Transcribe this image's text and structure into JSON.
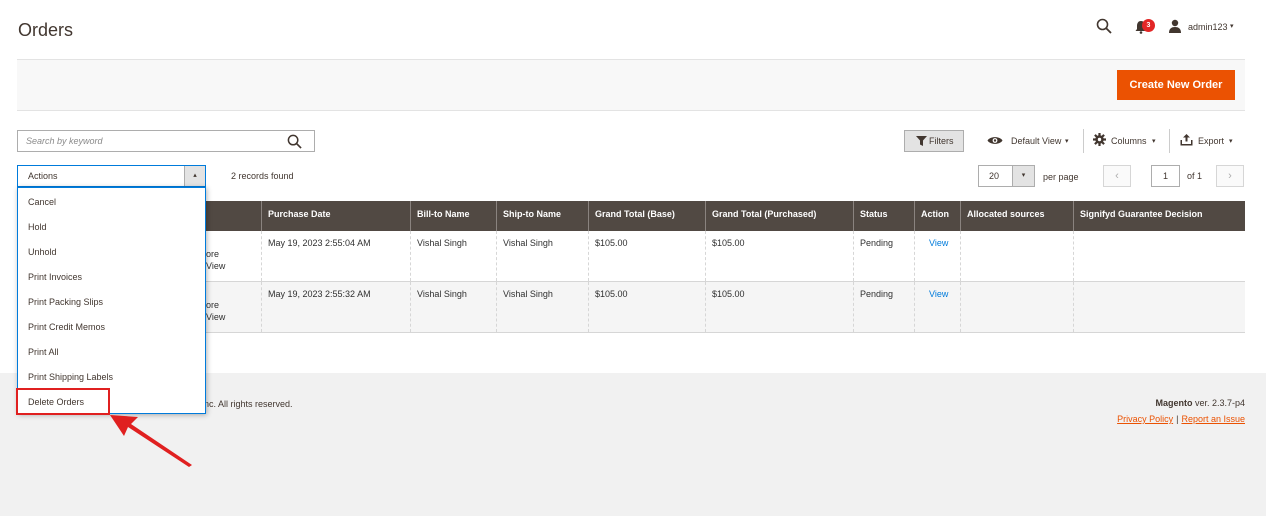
{
  "header": {
    "title": "Orders",
    "notification_count": "3",
    "username": "admin123",
    "caret": "▾"
  },
  "toolbar": {
    "create_label": "Create New Order",
    "search_placeholder": "Search by keyword",
    "filters_label": "Filters",
    "view_label": "Default View",
    "columns_label": "Columns",
    "export_label": "Export"
  },
  "mass_actions": {
    "label": "Actions",
    "toggle": "▴",
    "records": "2 records found",
    "options": [
      "Cancel",
      "Hold",
      "Unhold",
      "Print Invoices",
      "Print Packing Slips",
      "Print Credit Memos",
      "Print All",
      "Print Shipping Labels",
      "Delete Orders"
    ]
  },
  "pagination": {
    "per_page_value": "20",
    "per_page_toggle": "▾",
    "per_page_label": "per page",
    "prev": "‹",
    "next": "›",
    "page": "1",
    "of": "of 1"
  },
  "grid": {
    "columns": [
      "Purchase Date",
      "Bill-to Name",
      "Ship-to Name",
      "Grand Total (Base)",
      "Grand Total (Purchased)",
      "Status",
      "Action",
      "Allocated sources",
      "Signifyd Guarantee Decision"
    ],
    "partial_text": [
      "ore",
      "View"
    ],
    "rows": [
      {
        "purchase_date": "May 19, 2023 2:55:04 AM",
        "bill_to": "Vishal Singh",
        "ship_to": "Vishal Singh",
        "total_base": "$105.00",
        "total_purchased": "$105.00",
        "status": "Pending",
        "action": "View"
      },
      {
        "purchase_date": "May 19, 2023 2:55:32 AM",
        "bill_to": "Vishal Singh",
        "ship_to": "Vishal Singh",
        "total_base": "$105.00",
        "total_purchased": "$105.00",
        "status": "Pending",
        "action": "View"
      }
    ]
  },
  "footer": {
    "copyright": "nc. All rights reserved.",
    "brand": "Magento",
    "version": " ver. 2.3.7-p4",
    "privacy": "Privacy Policy",
    "pipe": "|",
    "report": "Report an Issue"
  },
  "colors": {
    "accent": "#eb5202",
    "grid_header": "#514943",
    "link": "#007bdb",
    "highlight": "#e02020"
  }
}
